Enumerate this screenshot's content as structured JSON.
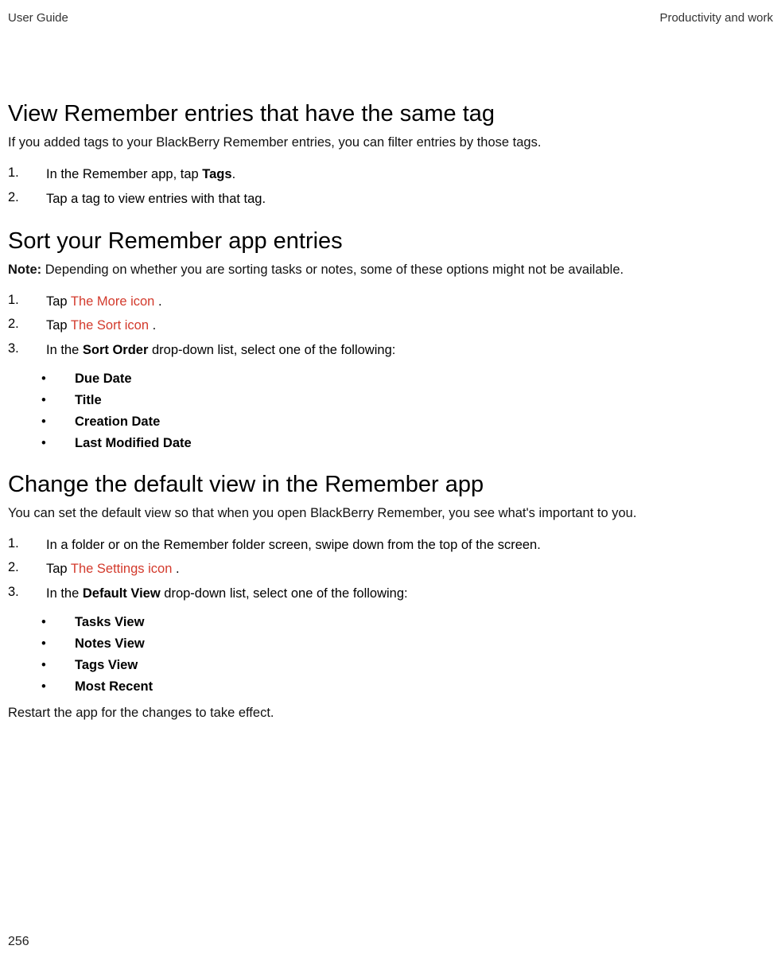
{
  "header": {
    "left": "User Guide",
    "right": "Productivity and work"
  },
  "page_number": "256",
  "sections": [
    {
      "heading": "View Remember entries that have the same tag",
      "intro": "If you added tags to your BlackBerry Remember entries, you can filter entries by those tags.",
      "steps": [
        {
          "num": "1.",
          "pre": "In the Remember app, tap ",
          "bold": "Tags",
          "post": "."
        },
        {
          "num": "2.",
          "text": "Tap a tag to view entries with that tag."
        }
      ]
    },
    {
      "heading": "Sort your Remember app entries",
      "note_label": "Note:",
      "note_body": " Depending on whether you are sorting tasks or notes, some of these options might not be available.",
      "steps": [
        {
          "num": "1.",
          "pre": "Tap ",
          "icon": " The More icon ",
          "post": "."
        },
        {
          "num": "2.",
          "pre": "Tap ",
          "icon": " The Sort icon ",
          "post": "."
        },
        {
          "num": "3.",
          "pre": "In the ",
          "bold": "Sort Order",
          "post": " drop-down list, select one of the following:"
        }
      ],
      "bullets": [
        "Due Date",
        "Title",
        "Creation Date",
        "Last Modified Date"
      ]
    },
    {
      "heading": "Change the default view in the Remember app",
      "intro": "You can set the default view so that when you open BlackBerry Remember, you see what's important to you.",
      "steps": [
        {
          "num": "1.",
          "text": "In a folder or on the Remember folder screen, swipe down from the top of the screen."
        },
        {
          "num": "2.",
          "pre": "Tap ",
          "icon": " The Settings icon ",
          "post": "."
        },
        {
          "num": "3.",
          "pre": "In the ",
          "bold": "Default View",
          "post": " drop-down list, select one of the following:"
        }
      ],
      "bullets": [
        "Tasks View",
        "Notes View",
        "Tags View",
        "Most Recent"
      ],
      "outro": "Restart the app for the changes to take effect."
    }
  ]
}
